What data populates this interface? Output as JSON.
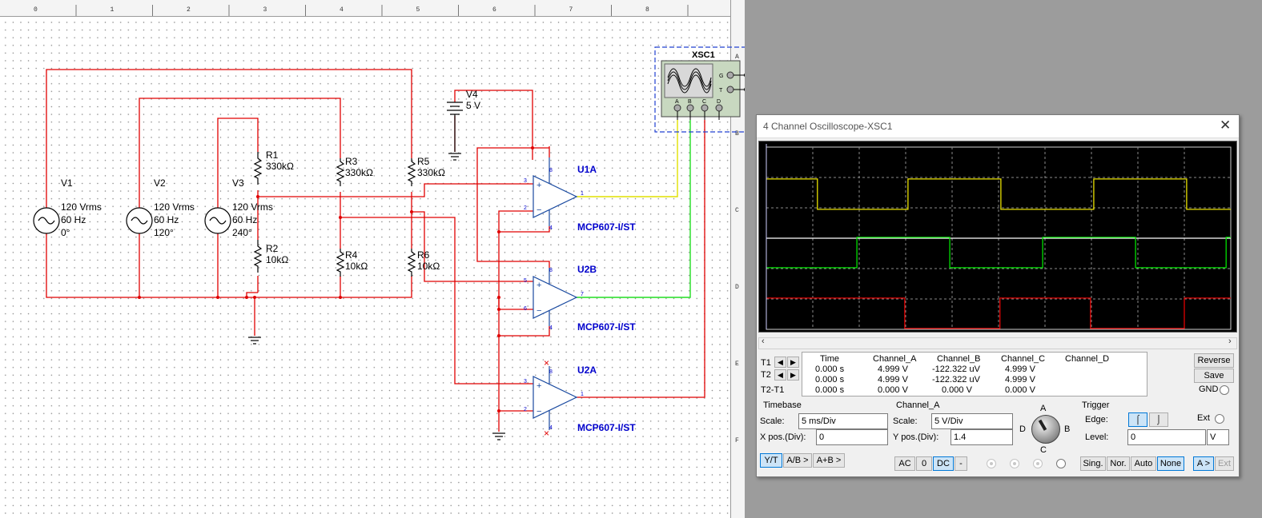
{
  "ruler": {
    "top_numbers": [
      "0",
      "1",
      "2",
      "3",
      "4",
      "5",
      "6",
      "7",
      "8"
    ],
    "right_letters": [
      "A",
      "B",
      "C",
      "D",
      "E",
      "F"
    ]
  },
  "schematic": {
    "sources": [
      {
        "name": "V1",
        "voltage": "120 Vrms",
        "freq": "60 Hz",
        "phase": "0°"
      },
      {
        "name": "V2",
        "voltage": "120 Vrms",
        "freq": "60 Hz",
        "phase": "120°"
      },
      {
        "name": "V3",
        "voltage": "120 Vrms",
        "freq": "60 Hz",
        "phase": "240°"
      }
    ],
    "resistors": [
      {
        "name": "R1",
        "value": "330kΩ"
      },
      {
        "name": "R2",
        "value": "10kΩ"
      },
      {
        "name": "R3",
        "value": "330kΩ"
      },
      {
        "name": "R4",
        "value": "10kΩ"
      },
      {
        "name": "R5",
        "value": "330kΩ"
      },
      {
        "name": "R6",
        "value": "10kΩ"
      }
    ],
    "dc_source": {
      "name": "V4",
      "value": "5 V"
    },
    "opamps": [
      {
        "name": "U1A",
        "part": "MCP607-I/ST",
        "pins": [
          "8",
          "3",
          "2",
          "1",
          "4"
        ]
      },
      {
        "name": "U2B",
        "part": "MCP607-I/ST",
        "pins": [
          "8",
          "5",
          "6",
          "7",
          "4"
        ]
      },
      {
        "name": "U2A",
        "part": "MCP607-I/ST",
        "pins": [
          "8",
          "3",
          "2",
          "1",
          "4"
        ]
      }
    ],
    "scope_icon": {
      "name": "XSC1",
      "top_pins": [
        "G",
        "T"
      ],
      "bottom_pins": [
        "A",
        "B",
        "C",
        "D"
      ]
    }
  },
  "oscilloscope": {
    "title": "4 Channel Oscilloscope-XSC1",
    "colors": {
      "channel_a": "#e8e000",
      "channel_b": "#00e000",
      "channel_c": "#e00000",
      "channel_d": "#ffffff"
    },
    "readout": {
      "headers": [
        "Time",
        "Channel_A",
        "Channel_B",
        "Channel_C",
        "Channel_D"
      ],
      "rows": [
        {
          "label": "T1",
          "time": "0.000 s",
          "a": "4.999 V",
          "b": "-122.322 uV",
          "c": "4.999 V"
        },
        {
          "label": "T2",
          "time": "0.000 s",
          "a": "4.999 V",
          "b": "-122.322 uV",
          "c": "4.999 V"
        },
        {
          "label": "T2-T1",
          "time": "0.000 s",
          "a": "0.000 V",
          "b": "0.000 V",
          "c": "0.000 V"
        }
      ]
    },
    "buttons": {
      "reverse": "Reverse",
      "save": "Save",
      "gnd": "GND"
    },
    "timebase": {
      "title": "Timebase",
      "scale_label": "Scale:",
      "scale": "5 ms/Div",
      "xpos_label": "X pos.(Div):",
      "xpos": "0",
      "modes": [
        "Y/T",
        "A/B >",
        "A+B >"
      ],
      "active_mode": "Y/T"
    },
    "channel": {
      "title": "Channel_A",
      "scale_label": "Scale:",
      "scale": "5  V/Div",
      "ypos_label": "Y pos.(Div):",
      "ypos": "1.4",
      "coupling": [
        "AC",
        "0",
        "DC",
        "-"
      ],
      "active_coupling": "DC",
      "knob_letters": [
        "A",
        "B",
        "C",
        "D"
      ]
    },
    "trigger": {
      "title": "Trigger",
      "edge_label": "Edge:",
      "ext_label": "Ext",
      "level_label": "Level:",
      "level": "0",
      "level_unit": "V",
      "modes": [
        "Sing.",
        "Nor.",
        "Auto",
        "None"
      ],
      "active_mode": "None",
      "source": [
        "A >",
        "Ext"
      ]
    },
    "waveforms": {
      "divisions": {
        "x": 10,
        "y": 6
      },
      "channel_a": {
        "low": 1.05,
        "high": 2.05,
        "transitions": [
          1.1,
          3.05,
          5.05,
          7.05,
          9.05,
          10.3
        ],
        "start_high": true
      },
      "channel_b": {
        "low": 2.97,
        "high": 3.97,
        "transitions": [
          1.95,
          3.95,
          5.95,
          7.95,
          9.9
        ],
        "start_high": false
      },
      "channel_c": {
        "low": 4.97,
        "high": 5.97,
        "transitions": [
          2.98,
          5.03,
          6.98,
          9.0
        ],
        "start_high": true
      }
    }
  }
}
